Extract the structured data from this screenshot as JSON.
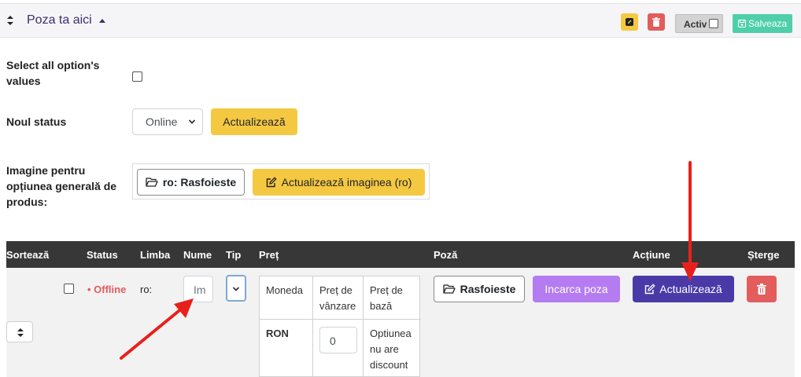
{
  "header": {
    "title": "Poza ta aici",
    "activ_label": "Activ",
    "save_label": "Salveaza"
  },
  "form": {
    "select_all_label": "Select all option's values",
    "new_status_label": "Noul status",
    "status_select_value": "Online",
    "status_update_label": "Actualizează",
    "image_label": "Imagine pentru opțiunea generală de produs:",
    "browse_label": "ro: Rasfoieste",
    "update_image_label": "Actualizează imaginea (ro)"
  },
  "table": {
    "headers": {
      "sort": "Sortează",
      "status": "Status",
      "limba": "Limba",
      "nume": "Nume",
      "tip": "Tip",
      "pret": "Preț",
      "poza": "Poză",
      "actiune": "Acțiune",
      "sterge": "Șterge"
    },
    "row": {
      "status": "• Offline",
      "limba": "ro:",
      "name_value": "Im",
      "price": {
        "col_currency": "Moneda",
        "col_sale": "Preț de vânzare",
        "col_base": "Preț de bază",
        "currency": "RON",
        "sale_value": "0",
        "base_note": "Optiunea nu are discount"
      },
      "browse_label": "Rasfoieste",
      "upload_label": "Incarca poza",
      "update_label": "Actualizează"
    }
  },
  "colors": {
    "header_bg": "#f5f5f7",
    "title": "#3d2d6b",
    "yellow": "#f5c842",
    "red": "#e35d5d",
    "green": "#4fcfa9",
    "purple": "#b57cf2",
    "indigo": "#4a3aa8",
    "table_header": "#373737",
    "offline": "#e25c5c",
    "annotation_arrow": "#e8201c"
  },
  "icons": {
    "sort": "sort-icon",
    "edit": "edit-icon",
    "trash": "trash-icon",
    "save": "save-icon",
    "folder": "folder-open-icon",
    "edit_square": "pen-square-icon"
  }
}
